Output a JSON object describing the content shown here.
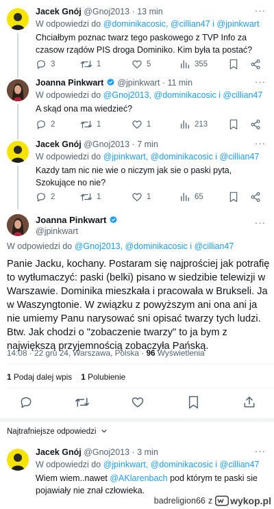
{
  "replies": [
    {
      "name": "Jacek Gnój",
      "handle": "@Gnoj2013",
      "time": "· 13 min",
      "replying_prefix": "W odpowiedzi do",
      "replying_to": "@dominikacosic, @cillian47 i @jpinkwart",
      "text": "Chciałbym poznac twarz tego paskowego z TVP Info za czasow rządów PIS droga Dominiko. Kim była ta postać?",
      "replies_count": "3",
      "reposts_count": "1",
      "likes_count": "5",
      "views_count": "355"
    },
    {
      "name": "Joanna Pinkwart",
      "handle": "@jpinkwart",
      "time": "· 11 min",
      "replying_prefix": "W odpowiedzi do",
      "replying_to": "@Gnoj2013, @dominikacosic i @cillian47",
      "text": "A skąd ona ma wiedzieć?",
      "replies_count": "2",
      "reposts_count": "1",
      "likes_count": "1",
      "views_count": "213"
    },
    {
      "name": "Jacek Gnój",
      "handle": "@Gnoj2013",
      "time": "· 7 min",
      "replying_prefix": "W odpowiedzi do",
      "replying_to": "@jpinkwart, @dominikacosic i @cillian47",
      "text": "Kazdy tam nic nie wie o niczym jak sie o paski pyta, Szokujące no nie?",
      "replies_count": "2",
      "reposts_count": "1",
      "likes_count": "1",
      "views_count": "65"
    }
  ],
  "main_post": {
    "name": "Joanna Pinkwart",
    "handle": "@jpinkwart",
    "replying_prefix": "W odpowiedzi do",
    "replying_to": "@Gnoj2013, @dominikacosic i @cillian47",
    "text": "Panie Jacku, kochany. Postaram się najprościej jak potrafię to wytłumaczyć: paski (belki) pisano w siedzibie telewizji w Warszawie. Dominika mieszkała i pracowała w Brukseli. Ja w Waszyngtonie. W związku z powyższym ani ona ani ja nie umiemy Panu narysować sni opisać twarzy tych ludzi. Btw. Jak chodzi o \"zobaczenie twarzy\" to ja bym z największą przyjemnością zobaczyła Pańską.",
    "timestamp": "14:08 · 22 gru 24, Warszawa, Polska ·",
    "views_number": "96",
    "views_label": "Wyświetlenia",
    "reposts_number": "1",
    "reposts_label": "Podaj dalej wpis",
    "likes_number": "1",
    "likes_label": "Polubienie"
  },
  "sort_label": "Najtrafniejsze odpowiedzi",
  "last_reply": {
    "name": "Jacek Gnój",
    "handle": "@Gnoj2013",
    "time": "· 3 min",
    "replying_prefix": "W odpowiedzi do",
    "replying_to": "@jpinkwart, @dominikacosic i @cillian47",
    "text_before": "Wiem wiem..nawet ",
    "text_mention": "@AKlarenbach",
    "text_after": " pod którym te paski sie pojawiały nie znał człowieka."
  },
  "watermark": {
    "user": "badreligion66",
    "sep": "z",
    "site": "wykop.pl"
  },
  "colors": {
    "accent": "#1d9bf0",
    "text": "#0f1419",
    "muted": "#536471"
  }
}
